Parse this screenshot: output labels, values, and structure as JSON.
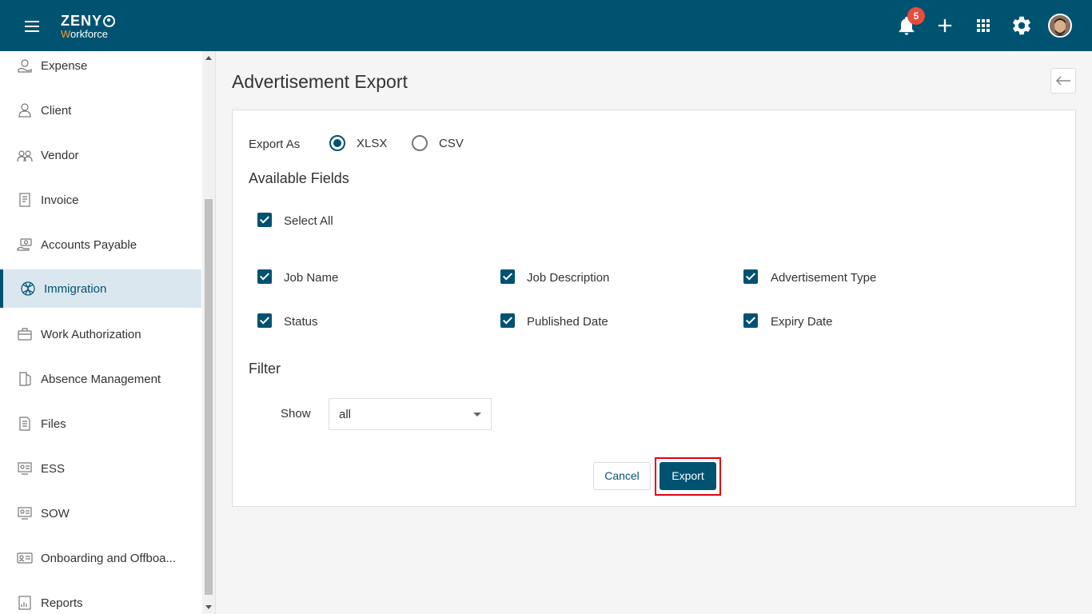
{
  "header": {
    "logo_top": "ZENY",
    "logo_bottom_accent": "W",
    "logo_bottom_rest": "orkforce",
    "notification_count": "5",
    "icons": [
      "menu-icon",
      "bell-icon",
      "plus-icon",
      "apps-grid-icon",
      "gear-icon",
      "avatar"
    ]
  },
  "sidebar": {
    "items": [
      {
        "label": "Expense",
        "icon": "expense-icon"
      },
      {
        "label": "Client",
        "icon": "person-icon"
      },
      {
        "label": "Vendor",
        "icon": "vendor-icon"
      },
      {
        "label": "Invoice",
        "icon": "invoice-icon"
      },
      {
        "label": "Accounts Payable",
        "icon": "accounts-payable-icon"
      },
      {
        "label": "Immigration",
        "icon": "globe-icon",
        "active": true
      },
      {
        "label": "Work Authorization",
        "icon": "briefcase-icon"
      },
      {
        "label": "Absence Management",
        "icon": "exit-door-icon"
      },
      {
        "label": "Files",
        "icon": "file-icon"
      },
      {
        "label": "ESS",
        "icon": "ess-icon"
      },
      {
        "label": "SOW",
        "icon": "sow-icon"
      },
      {
        "label": "Onboarding and Offboa...",
        "icon": "id-card-icon"
      },
      {
        "label": "Reports",
        "icon": "report-icon"
      }
    ]
  },
  "main": {
    "title": "Advertisement Export",
    "export_as": {
      "label": "Export As",
      "options": [
        {
          "label": "XLSX",
          "selected": true
        },
        {
          "label": "CSV",
          "selected": false
        }
      ]
    },
    "available_fields": {
      "title": "Available Fields",
      "select_all": "Select All",
      "fields": [
        {
          "label": "Job Name",
          "checked": true
        },
        {
          "label": "Job Description",
          "checked": true
        },
        {
          "label": "Advertisement Type",
          "checked": true
        },
        {
          "label": "Status",
          "checked": true
        },
        {
          "label": "Published Date",
          "checked": true
        },
        {
          "label": "Expiry Date",
          "checked": true
        }
      ]
    },
    "filter": {
      "title": "Filter",
      "show_label": "Show",
      "show_value": "all"
    },
    "buttons": {
      "cancel": "Cancel",
      "export": "Export"
    }
  },
  "colors": {
    "primary": "#005271",
    "badge": "#e74c3c",
    "highlight": "#e3000f",
    "logo_accent": "#f39c34"
  }
}
